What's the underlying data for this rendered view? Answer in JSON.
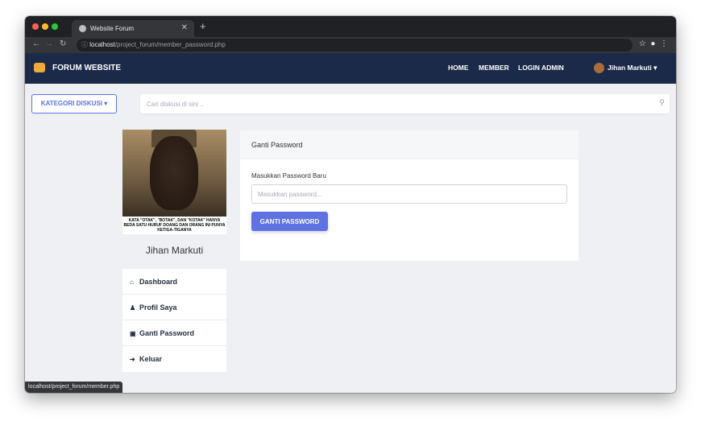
{
  "browser": {
    "tab_title": "Website Forum",
    "url_host": "localhost",
    "url_path": "/project_forum/member_password.php",
    "status_url": "localhost/project_forum/member.php"
  },
  "navbar": {
    "brand": "FORUM WEBSITE",
    "links": [
      "HOME",
      "MEMBER",
      "LOGIN ADMIN"
    ],
    "user_name": "Jihan Markuti ▾"
  },
  "toolbar": {
    "kategori_label": "KATEGORI DISKUSI ▾",
    "search_placeholder": "Cari diskusi di sini .."
  },
  "profile": {
    "photo_caption": "KATA \"OTAK\", \"BOTAK\", DAN \"KOTAK\" HANYA BEDA SATU HURUF DOANG DAN ORANG INI PUNYA KETIGA-TIGANYA",
    "name": "Jihan Markuti"
  },
  "sidebar": {
    "items": [
      {
        "label": "Dashboard",
        "icon": "home-icon"
      },
      {
        "label": "Profil Saya",
        "icon": "user-icon"
      },
      {
        "label": "Ganti Password",
        "icon": "lock-icon"
      },
      {
        "label": "Keluar",
        "icon": "sign-out-icon"
      }
    ]
  },
  "card": {
    "title": "Ganti Password",
    "field_label": "Masukkan Password Baru",
    "field_placeholder": "Masukkan password...",
    "submit_label": "GANTI PASSWORD"
  },
  "colors": {
    "navbar": "#1b2a49",
    "accent": "#5e72e4"
  }
}
